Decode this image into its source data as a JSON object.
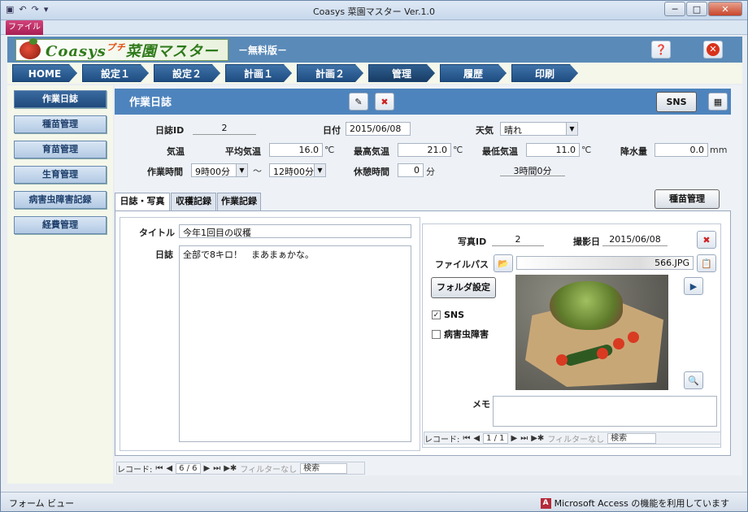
{
  "window": {
    "title": "Coasys 菜園マスター Ver.1.0",
    "file_tab": "ファイル"
  },
  "header": {
    "logo_text": "Coasys",
    "logo_sub": "プチ",
    "logo_main": "菜園マスター",
    "edition": "－無料版－"
  },
  "nav_tabs": [
    "HOME",
    "設定１",
    "設定２",
    "計画１",
    "計画２",
    "管理",
    "履歴",
    "印刷"
  ],
  "sidebar": [
    "作業日誌",
    "種苗管理",
    "育苗管理",
    "生育管理",
    "病害虫障害記録",
    "経費管理"
  ],
  "main": {
    "title": "作業日誌",
    "sns_button": "SNS"
  },
  "form": {
    "diary_id_label": "日誌ID",
    "diary_id": "2",
    "date_label": "日付",
    "date": "2015/06/08",
    "weather_label": "天気",
    "weather": "晴れ",
    "temp_label": "気温",
    "avg_label": "平均気温",
    "avg": "16.0",
    "avg_unit": "℃",
    "max_label": "最高気温",
    "max": "21.0",
    "max_unit": "℃",
    "min_label": "最低気温",
    "min": "11.0",
    "min_unit": "℃",
    "rain_label": "降水量",
    "rain": "0.0",
    "rain_unit": "mm",
    "worktime_label": "作業時間",
    "start": "9時00分",
    "tilde": "～",
    "end": "12時00分",
    "break_label": "休憩時間",
    "break": "0",
    "break_unit": "分",
    "total": "3時間0分"
  },
  "tabs": [
    "日誌・写真",
    "収穫記録",
    "作業記録"
  ],
  "seed_button": "種苗管理",
  "diary": {
    "title_label": "タイトル",
    "title": "今年1回目の収穫",
    "body_label": "日誌",
    "body": "全部で8キロ！　まあまぁかな。"
  },
  "photo": {
    "id_label": "写真ID",
    "id": "2",
    "date_label": "撮影日",
    "date": "2015/06/08",
    "path_label": "ファイルパス",
    "path": "566.JPG",
    "folder_button": "フォルダ設定",
    "sns_check": "SNS",
    "pest_check": "病害虫障害",
    "memo_label": "メモ",
    "memo": ""
  },
  "photo_nav": {
    "label": "レコード:",
    "pos": "1 / 1",
    "filter": "フィルターなし",
    "search": "検索"
  },
  "main_nav": {
    "label": "レコード:",
    "pos": "6 / 6",
    "filter": "フィルターなし",
    "search": "検索"
  },
  "status": {
    "left": "フォーム ビュー",
    "right": "Microsoft Access の機能を利用しています",
    "access_icon": "A"
  }
}
